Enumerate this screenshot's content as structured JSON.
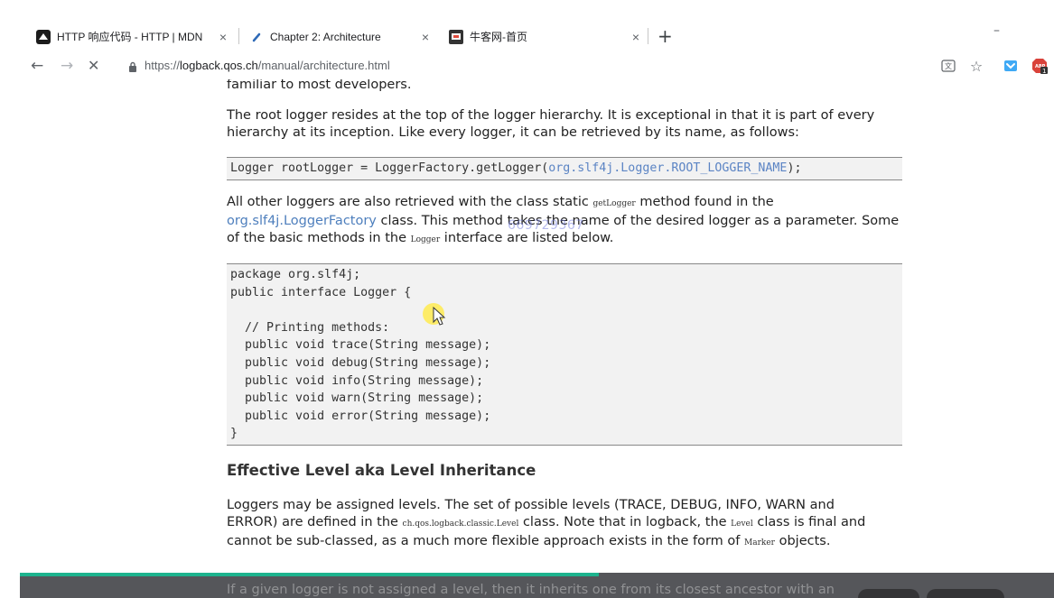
{
  "browser": {
    "tabs": [
      {
        "title": "HTTP 响应代码 - HTTP | MDN",
        "active": false,
        "close": "×"
      },
      {
        "title": "Chapter 2: Architecture",
        "active": true,
        "close": "×"
      },
      {
        "title": "牛客网-首页",
        "active": false,
        "close": "×"
      }
    ],
    "new_tab": "+",
    "minimize": "–",
    "nav": {
      "back": "←",
      "forward": "→",
      "stop": "✕"
    },
    "url": {
      "scheme": "https://",
      "host": "logback.qos.ch",
      "path": "/manual/architecture.html"
    },
    "toolbar_icons": [
      "translate-icon",
      "bookmark-star-icon",
      "pocket-icon",
      "adblock-icon"
    ],
    "adblock_count": "1",
    "accent_color": "#1db38e"
  },
  "article": {
    "p0": "familiar to most developers.",
    "p1": "The root logger resides at the top of the logger hierarchy. It is exceptional in that it is part of every hierarchy at its inception. Like every logger, it can be retrieved by its name, as follows:",
    "code1": {
      "text": "Logger rootLogger = LoggerFactory.getLogger(",
      "highlight": "org.slf4j.Logger.ROOT_LOGGER_NAME",
      "tail": ");"
    },
    "p2": {
      "a": "All other loggers are also retrieved with the class static ",
      "code_a": "getLogger",
      "b": " method found in the ",
      "link": "org.slf4j.LoggerFactory",
      "c": " class. This method takes the name of the desired logger as a parameter. Some of the basic methods in the ",
      "code_b": "Logger",
      "d": " interface are listed below."
    },
    "code2": [
      "package org.slf4j;",
      "public interface Logger {",
      "",
      "  // Printing methods:",
      "  public void trace(String message);",
      "  public void debug(String message);",
      "  public void info(String message);",
      "  public void warn(String message);",
      "  public void error(String message);",
      "}"
    ],
    "heading": "Effective Level aka Level Inheritance",
    "p3": {
      "a": "Loggers may be assigned levels. The set of possible levels (TRACE, DEBUG, INFO, WARN and ERROR) are defined in the ",
      "code_a": "ch.qos.logback.classic.Level",
      "b": " class. Note that in logback, the ",
      "code_b": "Level",
      "c": " class is final and cannot be sub-classed, as a much more flexible approach exists in the form of ",
      "code_c": "Marker",
      "d": " objects."
    },
    "p4_partial": "If a given logger is not assigned a level, then it inherits one from its closest ancestor with an"
  },
  "watermark": "669729367",
  "video_overlay": {
    "progress": 0.56
  }
}
